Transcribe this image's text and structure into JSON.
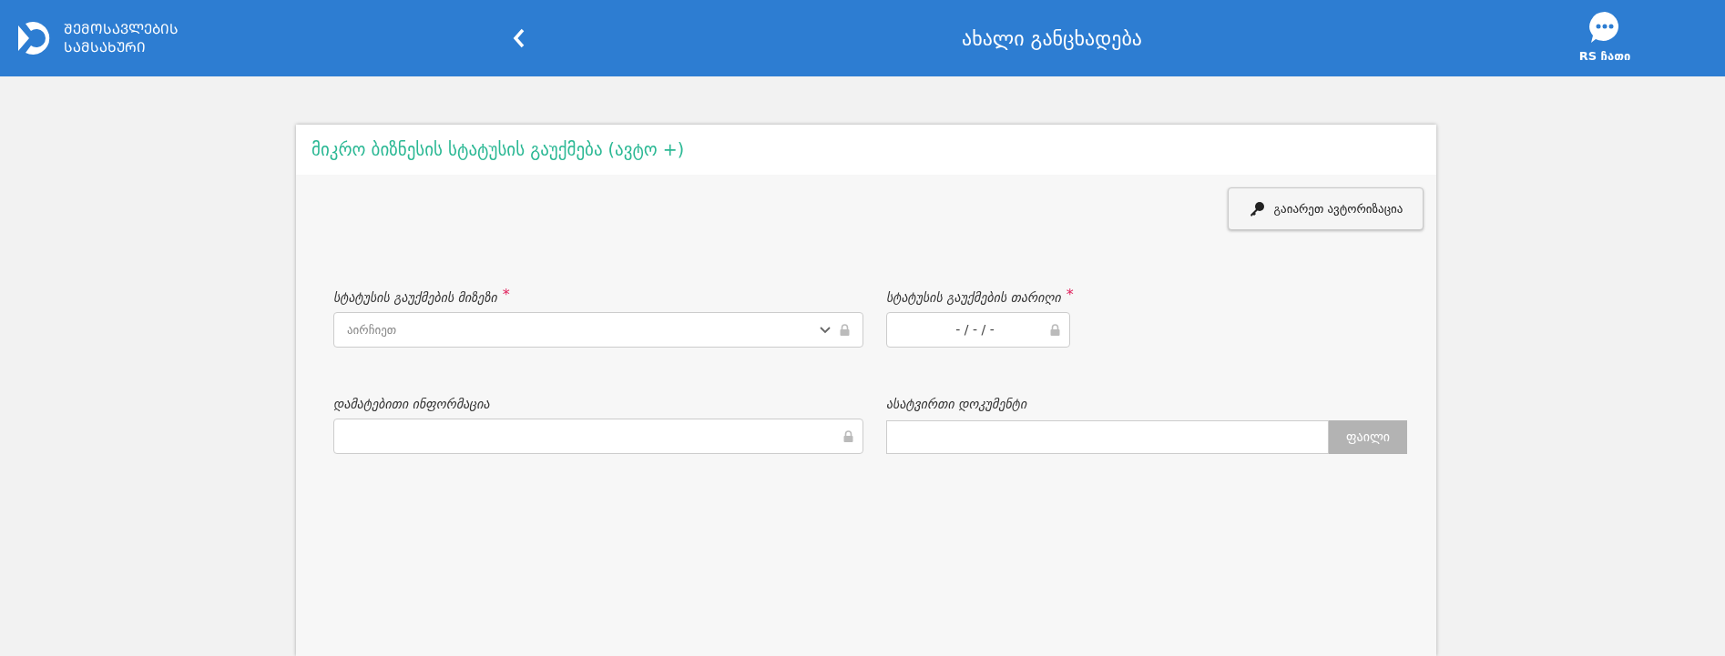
{
  "header": {
    "logo_text": [
      "ᲨᲔᲛᲝᲡᲐᲕᲚᲔᲑᲘᲡ",
      "ᲡᲐᲛᲡᲐᲮᲣᲠᲘ"
    ],
    "title": "ახალი განცხადება",
    "chat_label": "RS ჩათი"
  },
  "card": {
    "title": "მიკრო ბიზნესის სტატუსის გაუქმება (ავტო +)",
    "auth_button": "გაიარეთ ავტორიზაცია",
    "fields": [
      {
        "kind": "select",
        "label": "სტატუსის გაუქმების მიზეზი",
        "required_mark": "*",
        "locked": true,
        "placeholder": "აირჩიეთ"
      },
      {
        "kind": "date",
        "label": "სტატუსის გაუქმების თარიღი",
        "required_mark": "*",
        "locked": true,
        "value": "- / - / -"
      },
      {
        "kind": "text",
        "label": "დამატებითი ინფორმაცია",
        "locked": true
      },
      {
        "kind": "file",
        "label": "ასატვირთი დოკუმენტი",
        "locked": false,
        "button": "ფაილი"
      }
    ]
  }
}
